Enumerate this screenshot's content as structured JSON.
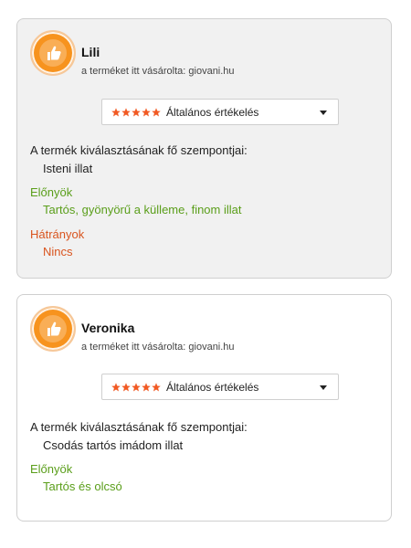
{
  "colors": {
    "star": "#f15a24",
    "badge": "#f7931e",
    "pros": "#5a9e1a",
    "cons": "#d9541e"
  },
  "reviews": [
    {
      "author": "Lili",
      "bought_prefix": "a terméket itt vásárolta: ",
      "bought_site": "giovani.hu",
      "rating_label": "Általános értékelés",
      "rating_stars": 5,
      "criteria_title": "A termék kiválasztásának fő szempontjai:",
      "criteria_value": "Isteni illat",
      "pros_title": "Előnyök",
      "pros_value": "Tartós, gyönyörű a külleme, finom illat",
      "cons_title": "Hátrányok",
      "cons_value": "Nincs"
    },
    {
      "author": "Veronika",
      "bought_prefix": "a terméket itt vásárolta: ",
      "bought_site": "giovani.hu",
      "rating_label": "Általános értékelés",
      "rating_stars": 5,
      "criteria_title": "A termék kiválasztásának fő szempontjai:",
      "criteria_value": "Csodás tartós imádom illat",
      "pros_title": "Előnyök",
      "pros_value": "Tartós és olcsó"
    }
  ]
}
